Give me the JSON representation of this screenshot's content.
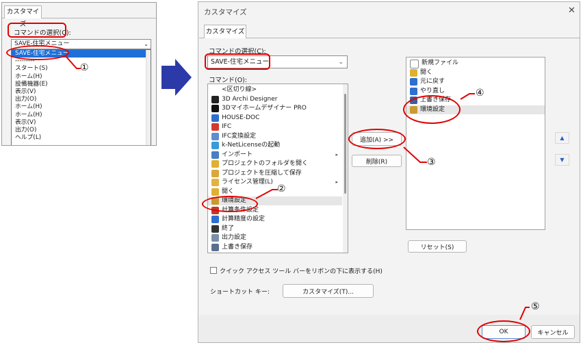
{
  "snippet": {
    "tab": "カスタマイズ",
    "label": "コマンドの選択(C):",
    "combo_value": "SAVE-住宅メニュー",
    "dropdown": [
      "SAVE-住宅メニュー",
      "---------",
      "スタート(S)",
      "ホーム(H)",
      "設備機器(E)",
      "表示(V)",
      "出力(O)",
      "ホーム(H)",
      "ホーム(H)",
      "表示(V)",
      "出力(O)",
      "ヘルプ(L)"
    ]
  },
  "dialog": {
    "title": "カスタマイズ",
    "tab": "カスタマイズ",
    "select_label": "コマンドの選択(C):",
    "select_value": "SAVE-住宅メニュー",
    "commands_label": "コマンド(O):",
    "commands": [
      {
        "label": "<区切り線>",
        "icon": "none",
        "color": "#ffffff"
      },
      {
        "label": "3D Archi Designer",
        "icon": "triangle-icon",
        "color": "#222222"
      },
      {
        "label": "3Dマイホームデザイナー PRO",
        "icon": "pro-icon",
        "color": "#111111"
      },
      {
        "label": "HOUSE-DOC",
        "icon": "house-icon",
        "color": "#2e6fd0"
      },
      {
        "label": "IFC",
        "icon": "ifc-icon",
        "color": "#d33a2f"
      },
      {
        "label": "IFC変換設定",
        "icon": "ifc-settings-icon",
        "color": "#5a8fd0"
      },
      {
        "label": "k-NetLicenseの起動",
        "icon": "network-icon",
        "color": "#3a9ad9"
      },
      {
        "label": "インポート",
        "icon": "import-icon",
        "color": "#4a7fc0",
        "sub": true
      },
      {
        "label": "プロジェクトのフォルダを開く",
        "icon": "folder-icon",
        "color": "#e0b030"
      },
      {
        "label": "プロジェクトを圧縮して保存",
        "icon": "archive-icon",
        "color": "#d9a73a"
      },
      {
        "label": "ライセンス管理(L)",
        "icon": "license-icon",
        "color": "#e3b341",
        "sub": true
      },
      {
        "label": "開く",
        "icon": "open-icon",
        "color": "#e0b030"
      },
      {
        "label": "環境設定",
        "icon": "tools-icon",
        "color": "#c99a2e",
        "hl": true
      },
      {
        "label": "計算条件設定",
        "icon": "calc-settings-icon",
        "color": "#c0392b"
      },
      {
        "label": "計算精度の設定",
        "icon": "precision-icon",
        "color": "#2e6fd0"
      },
      {
        "label": "終了",
        "icon": "close-icon",
        "color": "#333333"
      },
      {
        "label": "出力設定",
        "icon": "output-icon",
        "color": "#7a8fa8"
      },
      {
        "label": "上書き保存",
        "icon": "save-icon",
        "color": "#5a6f90"
      }
    ],
    "add_button": "追加(A) >>",
    "remove_button": "削除(R)",
    "right_list": [
      {
        "label": "新規ファイル",
        "icon": "new-file-icon",
        "color": "#ffffff"
      },
      {
        "label": "開く",
        "icon": "open-icon",
        "color": "#e0b030"
      },
      {
        "label": "元に戻す",
        "icon": "undo-icon",
        "color": "#2e6fd0"
      },
      {
        "label": "やり直し",
        "icon": "redo-icon",
        "color": "#2e6fd0"
      },
      {
        "label": "上書き保存",
        "icon": "save-icon",
        "color": "#3a5f9a"
      },
      {
        "label": "環境設定",
        "icon": "tools-icon",
        "color": "#c99a2e",
        "hl": true
      }
    ],
    "move_up": "▲",
    "move_down": "▼",
    "reset_button": "リセット(S)",
    "checkbox_label": "クイック アクセス ツール バーをリボンの下に表示する(H)",
    "shortcut_label": "ショートカット キー:",
    "customize_button": "カスタマイズ(T)...",
    "ok_button": "OK",
    "cancel_button": "キャンセル"
  },
  "annotations": {
    "n1": "①",
    "n2": "②",
    "n3": "③",
    "n4": "④",
    "n5": "⑤",
    "color": "#e00000"
  }
}
